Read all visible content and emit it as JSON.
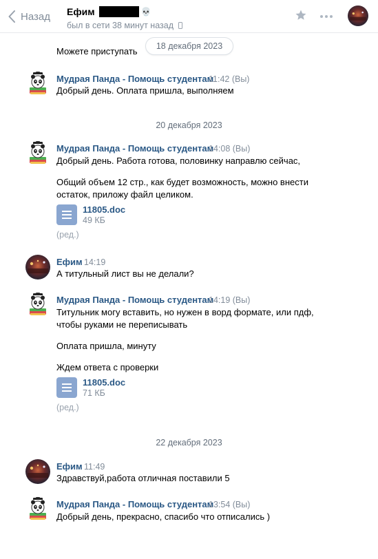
{
  "header": {
    "back_label": "Назад",
    "peer_name": "Ефим",
    "peer_status": "был в сети 38 минут назад"
  },
  "chat": {
    "top_text": "Можете приступать",
    "floating_date": "18 декабря 2023",
    "dates": [
      "20 декабря 2023",
      "22 декабря 2023"
    ],
    "messages": [
      {
        "author": "Мудрая Панда - Помощь студентам",
        "time": "11:42 (Вы)",
        "lines": [
          "Добрый день. Оплата пришла, выполняем"
        ]
      },
      {
        "author": "Мудрая Панда - Помощь студентам",
        "time": "14:08 (Вы)",
        "lines": [
          "Добрый день. Работа готова, половинку направлю сейчас,",
          "Общий объем 12 стр., как будет возможность, можно внести",
          "остаток, приложу файл целиком."
        ],
        "doc": {
          "name": "11805.doc",
          "size": "49 КБ"
        },
        "edited": "(ред.)"
      },
      {
        "author": "Ефим",
        "time": "14:19",
        "lines": [
          "А титульный лист вы не делали?"
        ]
      },
      {
        "author": "Мудрая Панда - Помощь студентам",
        "time": "14:19 (Вы)",
        "lines": [
          "Титульник могу вставить, но нужен в ворд формате, или пдф,",
          "чтобы руками не переписывать",
          "Оплата пришла, минуту",
          "Ждем ответа с проверки"
        ],
        "doc": {
          "name": "11805.doc",
          "size": "71 КБ"
        },
        "edited": "(ред.)"
      },
      {
        "author": "Ефим",
        "time": "11:49",
        "lines": [
          "Здравствуй,работа отличная поставили 5"
        ]
      },
      {
        "author": "Мудрая Панда - Помощь студентам",
        "time": "13:54 (Вы)",
        "lines": [
          "Добрый день, прекрасно, спасибо что отписались )"
        ]
      }
    ]
  },
  "icons": {
    "back": "chevron-left-icon",
    "star": "star-icon",
    "more": "more-dots-icon",
    "device": "mobile-phone-icon",
    "document": "document-icon"
  },
  "colors": {
    "link": "#2a5885",
    "muted": "#818c99",
    "doc_icon": "#8aa6d0"
  }
}
